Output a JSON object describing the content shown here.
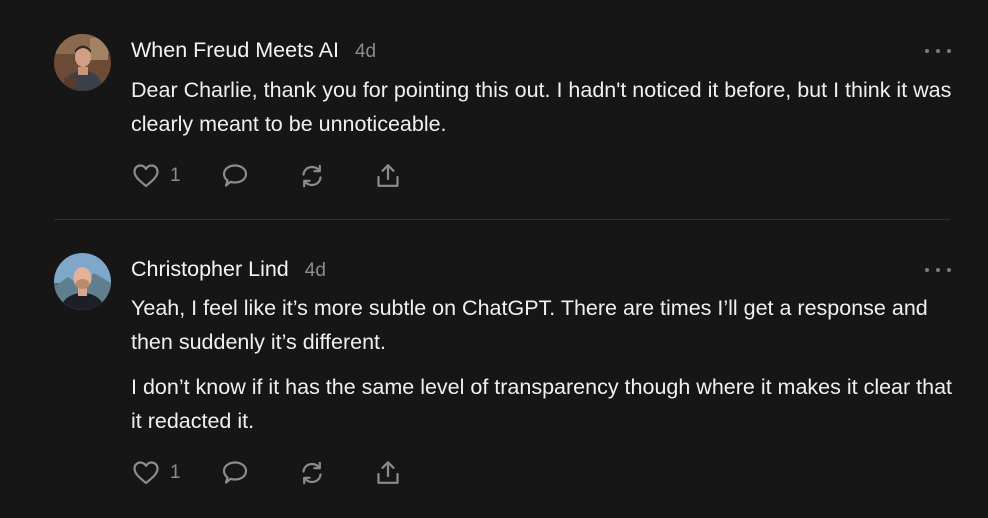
{
  "comments": [
    {
      "author": "When Freud Meets AI",
      "time": "4d",
      "paragraphs": [
        "Dear Charlie, thank you for pointing this out. I hadn't noticed it before, but I think it was clearly meant to be unnoticeable."
      ],
      "likes": "1",
      "avatar_icon": "person-avatar-freud"
    },
    {
      "author": "Christopher Lind",
      "time": "4d",
      "paragraphs": [
        "Yeah, I feel like it’s more subtle on ChatGPT. There are times I’ll get a response and then suddenly it’s different.",
        "I don’t know if it has the same level of transparency though where it makes it clear that it redacted it."
      ],
      "likes": "1",
      "avatar_icon": "person-avatar-lind"
    }
  ],
  "icons": {
    "like": "heart-icon",
    "reply": "speech-bubble-icon",
    "restack": "restack-icon",
    "share": "share-icon",
    "more": "ellipsis-icon"
  },
  "colors": {
    "background": "#161616",
    "text": "#f0f0f0",
    "muted": "#8c8c8c",
    "divider": "#333333"
  }
}
